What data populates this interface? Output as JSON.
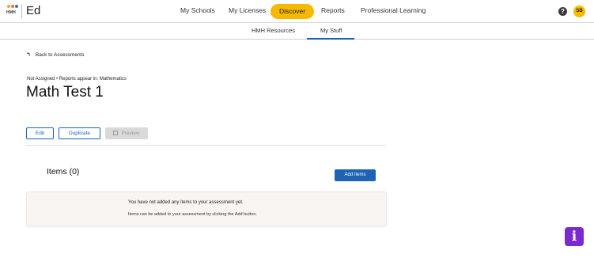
{
  "brand": {
    "logo_text": "HMH",
    "app_name": "Ed"
  },
  "topnav": {
    "items": [
      "My Schools",
      "My Licenses",
      "Discover",
      "Reports",
      "Professional Learning"
    ],
    "active": "Discover",
    "help_glyph": "?",
    "avatar_initials": "SB"
  },
  "subnav": {
    "items": [
      "HMH Resources",
      "My Stuff"
    ],
    "active": "My Stuff"
  },
  "page": {
    "back_label": "Back to Assessments",
    "meta": "Not Assigned • Reports appear in: Mathematics",
    "title": "Math Test 1",
    "buttons": {
      "edit": "Edit",
      "duplicate": "Duplicate",
      "preview": "Preview"
    },
    "items_heading": "Items (0)",
    "add_items": "Add Items",
    "empty_title": "You have not added any items to your assessment yet.",
    "empty_body": "Items can be added to your assessment by clicking the Add button."
  },
  "fab": {
    "glyph": "i"
  },
  "colors": {
    "accent_yellow": "#f7b800",
    "primary_blue": "#1d62b5",
    "fab_purple": "#7b2ad0"
  }
}
